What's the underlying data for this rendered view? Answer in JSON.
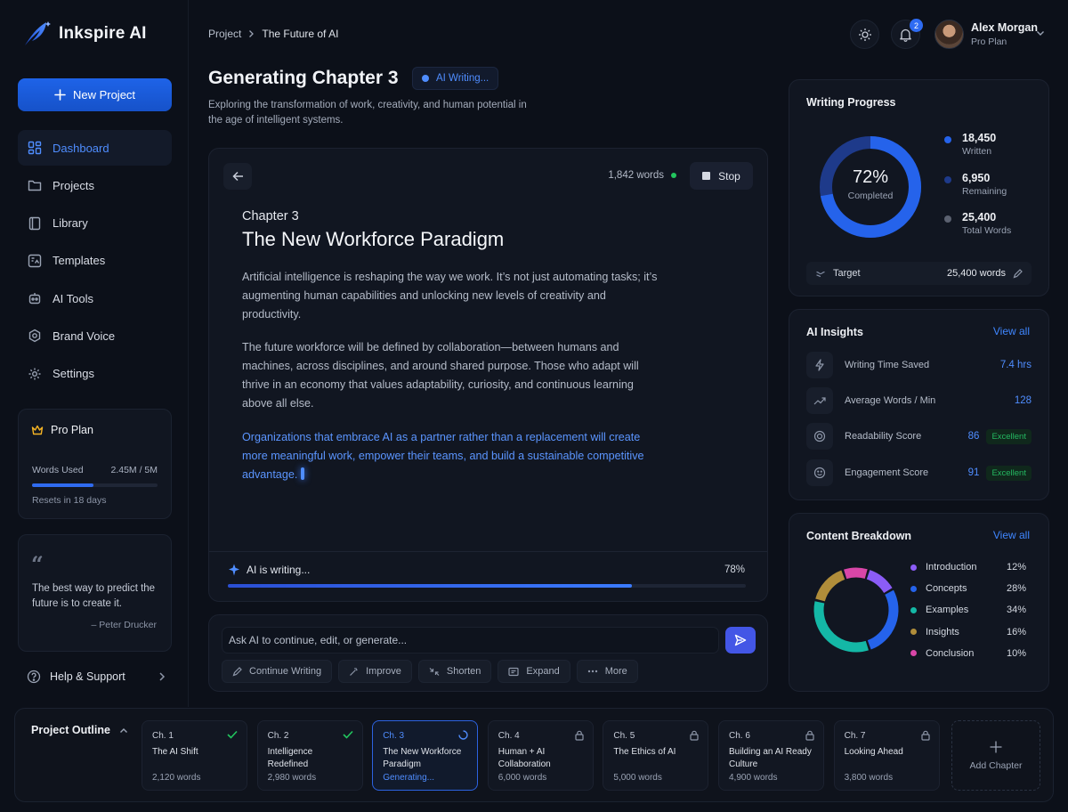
{
  "app": {
    "name": "Inkspire AI"
  },
  "sidebar": {
    "new_project": "New Project",
    "items": [
      {
        "label": "Dashboard",
        "icon": "dashboard-icon",
        "active": true
      },
      {
        "label": "Projects",
        "icon": "folder-icon"
      },
      {
        "label": "Library",
        "icon": "book-icon"
      },
      {
        "label": "Templates",
        "icon": "template-icon"
      },
      {
        "label": "AI Tools",
        "icon": "robot-icon"
      },
      {
        "label": "Brand Voice",
        "icon": "voice-icon"
      },
      {
        "label": "Settings",
        "icon": "gear-icon"
      }
    ],
    "plan": {
      "title": "Pro Plan",
      "words_label": "Words Used",
      "words_value": "2.45M / 5M",
      "usage_fraction": 0.49,
      "reset": "Resets in 18 days"
    },
    "quote": {
      "mark": "“",
      "text": "The best way to predict the future is to create it.",
      "author": "– Peter Drucker"
    },
    "help": "Help & Support"
  },
  "header": {
    "breadcrumb": [
      "Project",
      "The Future of AI"
    ],
    "notification_count": "2",
    "user": {
      "name": "Alex Morgan",
      "plan": "Pro Plan"
    }
  },
  "page": {
    "title": "Generating Chapter 3",
    "status": "AI Writing...",
    "subtitle": "Exploring the transformation of work, creativity, and human potential in the age of intelligent systems."
  },
  "editor": {
    "word_count": "1,842 words",
    "stop_label": "Stop",
    "chapter_label": "Chapter 3",
    "chapter_title": "The New Workforce Paradigm",
    "paragraphs": [
      "Artificial intelligence is reshaping the way we work. It’s not just automating tasks; it’s augmenting human capabilities and unlocking new levels of creativity and productivity.",
      "The future workforce will be defined by collaboration—between humans and machines, across disciplines, and around shared purpose. Those who adapt will thrive in an economy that values adaptability, curiosity, and continuous learning above all else.",
      "Organizations that embrace AI as a partner rather than a replacement will create more meaningful work, empower their teams, and build a sustainable competitive advantage."
    ],
    "writing_label": "AI is writing...",
    "writing_pct": "78%",
    "progress_fraction": 0.78
  },
  "prompt": {
    "placeholder": "Ask AI to continue, edit, or generate...",
    "actions": [
      "Continue Writing",
      "Improve",
      "Shorten",
      "Expand",
      "More"
    ]
  },
  "progress": {
    "title": "Writing Progress",
    "percent": "72%",
    "percent_value": 72,
    "caption": "Completed",
    "stats": [
      {
        "value": "18,450",
        "label": "Written",
        "color": "#2563eb"
      },
      {
        "value": "6,950",
        "label": "Remaining",
        "color": "#1e3a8a"
      },
      {
        "value": "25,400",
        "label": "Total Words",
        "color": "#5b6170"
      }
    ],
    "target_label": "Target",
    "target_value": "25,400 words"
  },
  "insights": {
    "title": "AI Insights",
    "link": "View all",
    "rows": [
      {
        "label": "Writing Time Saved",
        "value": "7.4 hrs",
        "icon": "bolt-icon"
      },
      {
        "label": "Average Words / Min",
        "value": "128",
        "icon": "trend-icon"
      },
      {
        "label": "Readability Score",
        "value": "86",
        "badge": "Excellent",
        "icon": "target-icon"
      },
      {
        "label": "Engagement Score",
        "value": "91",
        "badge": "Excellent",
        "icon": "smile-icon"
      }
    ]
  },
  "breakdown": {
    "title": "Content Breakdown",
    "link": "View all",
    "items": [
      {
        "label": "Introduction",
        "pct": "12%",
        "value": 12,
        "color": "#8b5cf6"
      },
      {
        "label": "Concepts",
        "pct": "28%",
        "value": 28,
        "color": "#2563eb"
      },
      {
        "label": "Examples",
        "pct": "34%",
        "value": 34,
        "color": "#14b8a6"
      },
      {
        "label": "Insights",
        "pct": "16%",
        "value": 16,
        "color": "#b08d3a"
      },
      {
        "label": "Conclusion",
        "pct": "10%",
        "value": 10,
        "color": "#d946a8"
      }
    ]
  },
  "outline": {
    "title": "Project Outline",
    "chapters": [
      {
        "num": "Ch. 1",
        "name": "The AI Shift",
        "words": "2,120 words",
        "state": "done"
      },
      {
        "num": "Ch. 2",
        "name": "Intelligence Redefined",
        "words": "2,980 words",
        "state": "done"
      },
      {
        "num": "Ch. 3",
        "name": "The New Workforce Paradigm",
        "words": "Generating...",
        "state": "current"
      },
      {
        "num": "Ch. 4",
        "name": "Human + AI Collaboration",
        "words": "6,000 words",
        "state": "locked"
      },
      {
        "num": "Ch. 5",
        "name": "The Ethics of AI",
        "words": "5,000 words",
        "state": "locked"
      },
      {
        "num": "Ch. 6",
        "name": "Building an AI Ready Culture",
        "words": "4,900 words",
        "state": "locked"
      },
      {
        "num": "Ch. 7",
        "name": "Looking Ahead",
        "words": "3,800 words",
        "state": "locked"
      }
    ],
    "add_label": "Add Chapter"
  }
}
